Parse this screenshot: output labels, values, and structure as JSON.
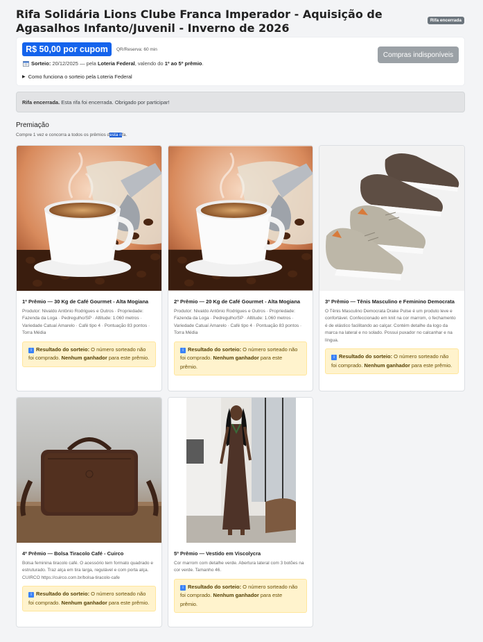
{
  "header": {
    "title": "Rifa Solidária Lions Clube Franca Imperador - Aquisição de Agasalhos Infanto/Juvenil - Inverno de 2026",
    "status_badge": "Rifa encerrada"
  },
  "info": {
    "price": "R$ 50,00 por cupom",
    "qr_note": "QR/Reserva: 60 min",
    "draw_label": "Sorteio:",
    "draw_date": "20/12/2025",
    "draw_sep": "— pela",
    "draw_source": "Loteria Federal",
    "draw_valid": ", valendo do",
    "draw_range": "1º ao 5º prêmio",
    "draw_end": ".",
    "how_it_works": "Como funciona o sorteio pela Loteria Federal",
    "buy_button": "Compras indisponíveis"
  },
  "alert": {
    "bold": "Rifa encerrada.",
    "text": " Esta rifa foi encerrada. Obrigado por participar!"
  },
  "section": {
    "title": "Premiação",
    "subtitle_pre": "Compre 1 vez e concorra a todos os prêmios d",
    "subtitle_hl": "esta ri",
    "subtitle_post": "fa."
  },
  "result_template": {
    "label": "Resultado do sorteio:",
    "text1": " O número sorteado não foi comprado. ",
    "bold2": "Nenhum ganhador",
    "text2": " para este prêmio."
  },
  "prizes": [
    {
      "title": "1º Prêmio — 30 Kg de Café Gourmet - Alta Mogiana",
      "desc": "Produtor: Nivaldo Antônio Rodrigues e Outros · Propriedade: Fazenda da Loga · Pedregulho/SP · Altitude: 1.060 metros · Variedade Catuaí Amarelo · Café tipo 4 · Pontuação 83 pontos · Torra Média",
      "image": "coffee-cup"
    },
    {
      "title": "2º Prêmio — 20 Kg de Café Gourmet - Alta Mogiana",
      "desc": "Produtor: Nivaldo Antônio Rodrigues e Outros · Propriedade: Fazenda da Loga · Pedregulho/SP · Altitude: 1.060 metros · Variedade Catuaí Amarelo · Café tipo 4 · Pontuação 83 pontos · Torra Média",
      "image": "coffee-cup"
    },
    {
      "title": "3º Prêmio — Tênis Masculino e Feminino Democrata",
      "desc": "O Tênis Masculino Democrata Drake Pulse é um produto leve e confortável. Confeccionado em knit na cor marrom, o fechamento é de elástico facilitando ao calçar. Contém detalhe da logo da marca na lateral e no solado. Possui puxador no calcanhar e na língua.",
      "image": "sneakers"
    },
    {
      "title": "4º Prêmio — Bolsa Tiracolo Café - Cuirco",
      "desc": "Bolsa feminina tiracolo café. O acessório tem formato quadrado e estruturado. Traz alça em tira larga, regulável e com porta alça. CUIRCO https://cuirco.com.br/bolsa-tiracolo-cafe",
      "image": "handbag"
    },
    {
      "title": "5º Prêmio — Vestido em Viscolycra",
      "desc": "Cor marrom com detalhe verde. Abertura lateral com 3 botões na cor verde. Tamanho 46.",
      "image": "dress"
    }
  ],
  "colors": {
    "price_badge": "#1463ec",
    "buy_disabled": "#9ba1a6",
    "alert_bg": "#e2e3e5",
    "result_bg": "#fff3cd",
    "status_badge": "#6c757d"
  }
}
